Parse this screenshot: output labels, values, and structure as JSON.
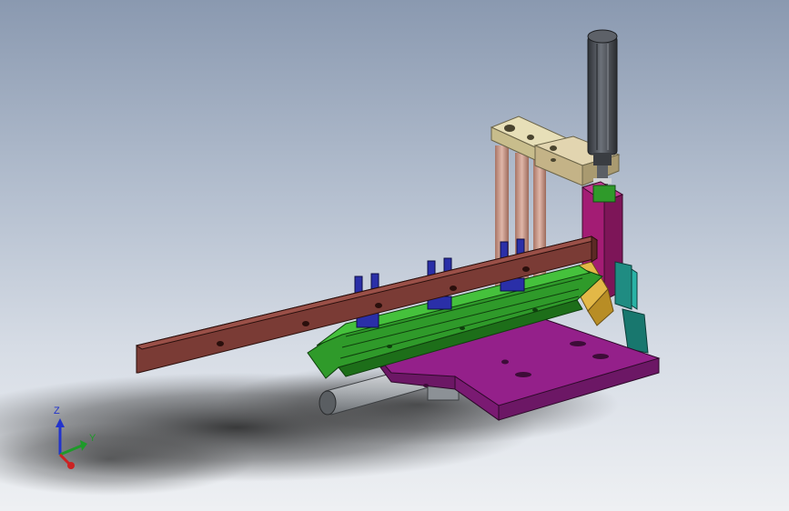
{
  "viewport": {
    "background_top": "#8a99b0",
    "background_bottom": "#eef0f3"
  },
  "model": {
    "parts": [
      {
        "name": "pneumatic-cylinder",
        "color": "#4a4e55"
      },
      {
        "name": "top-bracket",
        "color": "#d9cfa3"
      },
      {
        "name": "guide-rods",
        "color": "#c79a8a"
      },
      {
        "name": "vertical-column",
        "color": "#9c1a6e"
      },
      {
        "name": "base-plate",
        "color": "#8f1f82"
      },
      {
        "name": "long-bar",
        "color": "#7a3b35"
      },
      {
        "name": "green-rails",
        "color": "#2f9a2a"
      },
      {
        "name": "blue-clips",
        "color": "#2a2fa8"
      },
      {
        "name": "teal-block",
        "color": "#1f8c82"
      },
      {
        "name": "tan-wedge",
        "color": "#d5a93a"
      },
      {
        "name": "bottom-cylinder",
        "color": "#b9bdc1"
      }
    ]
  },
  "triad": {
    "z_label": "Z",
    "y_label": "Y",
    "z_color": "#2233cc",
    "y_color": "#1e9a2a",
    "x_color": "#cc2222"
  }
}
